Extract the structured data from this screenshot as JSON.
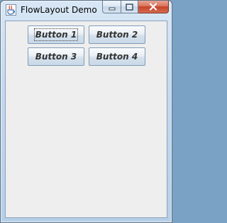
{
  "window": {
    "title": "FlowLayout Demo"
  },
  "buttons": [
    {
      "label": "Button 1",
      "focused": true
    },
    {
      "label": "Button 2",
      "focused": false
    },
    {
      "label": "Button 3",
      "focused": false
    },
    {
      "label": "Button 4",
      "focused": false
    }
  ],
  "colors": {
    "client_background": "#eeeeee",
    "close_button": "#c4432a",
    "button_text": "#333333"
  },
  "icons": [
    "java-cup-icon",
    "minimize-icon",
    "maximize-icon",
    "close-icon"
  ]
}
